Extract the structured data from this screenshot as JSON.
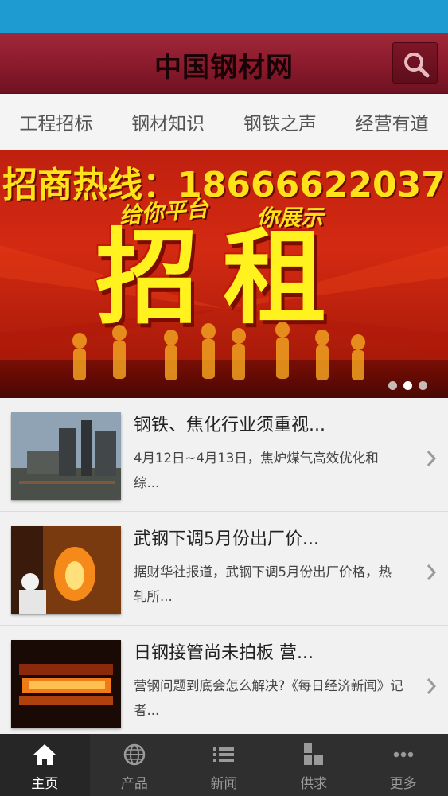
{
  "header": {
    "title": "中国钢材网"
  },
  "tabs": [
    {
      "label": "工程招标"
    },
    {
      "label": "钢材知识"
    },
    {
      "label": "钢铁之声"
    },
    {
      "label": "经营有道"
    }
  ],
  "banner": {
    "hotline": "招商热线：18666622037",
    "sub_a": "给你平台",
    "sub_b": "你展示",
    "big_text": "招租",
    "slide_count": 3,
    "active_slide": 2
  },
  "news": [
    {
      "title": "钢铁、焦化行业须重视...",
      "desc": "4月12日~4月13日，焦炉煤气高效优化和综...",
      "thumb": "steel-plant-photo"
    },
    {
      "title": "武钢下调5月份出厂价...",
      "desc": "据财华社报道，武钢下调5月份出厂价格，热轧所...",
      "thumb": "furnace-worker-photo"
    },
    {
      "title": "日钢接管尚未拍板 营...",
      "desc": "营钢问题到底会怎么解决?《每日经济新闻》记者...",
      "thumb": "hot-steel-slab-photo"
    }
  ],
  "bottom_nav": [
    {
      "label": "主页",
      "icon": "home-icon",
      "active": true
    },
    {
      "label": "产品",
      "icon": "globe-icon",
      "active": false
    },
    {
      "label": "新闻",
      "icon": "list-icon",
      "active": false
    },
    {
      "label": "供求",
      "icon": "grid-icon",
      "active": false
    },
    {
      "label": "更多",
      "icon": "more-icon",
      "active": false
    }
  ],
  "colors": {
    "status_bar": "#1e9bd0",
    "header": "#8a1a2c",
    "nav_bg": "#2f2f2f"
  }
}
